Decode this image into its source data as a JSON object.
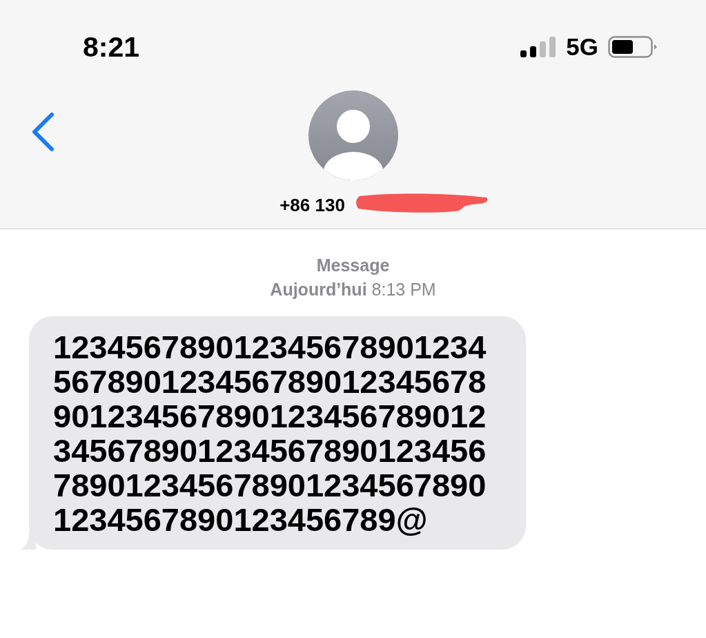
{
  "status_bar": {
    "time": "8:21",
    "network": "5G"
  },
  "contact": {
    "name": "+86 130"
  },
  "thread": {
    "service": "Message",
    "timestamp": "**Aujourd’hui** 8:13 PM"
  },
  "messages": [
    {
      "kind": "received",
      "text": "1234567890123456789012345678901234567890123456789012345678901234567890123456789012345678901234567890123456789012345678901234567890123456789@"
    }
  ]
}
